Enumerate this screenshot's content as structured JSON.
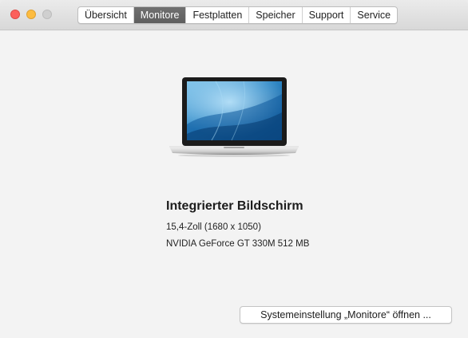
{
  "window": {
    "traffic_lights": [
      {
        "name": "close-icon",
        "color": "#fc605c"
      },
      {
        "name": "minimize-icon",
        "color": "#fdbc40"
      },
      {
        "name": "zoom-icon",
        "color": "#cfcfcf"
      }
    ]
  },
  "tabs": [
    {
      "label": "Übersicht",
      "active": false
    },
    {
      "label": "Monitore",
      "active": true
    },
    {
      "label": "Festplatten",
      "active": false
    },
    {
      "label": "Speicher",
      "active": false
    },
    {
      "label": "Support",
      "active": false
    },
    {
      "label": "Service",
      "active": false
    }
  ],
  "display": {
    "image": "macbook-pro-icon",
    "name": "Integrierter Bildschirm",
    "size": "15,4-Zoll (1680 x 1050)",
    "gpu": "NVIDIA GeForce GT 330M 512 MB"
  },
  "actions": {
    "open_settings_label": "Systemeinstellung „Monitore“ öffnen ..."
  },
  "colors": {
    "active_tab": "#666666",
    "background": "#f3f3f3"
  }
}
